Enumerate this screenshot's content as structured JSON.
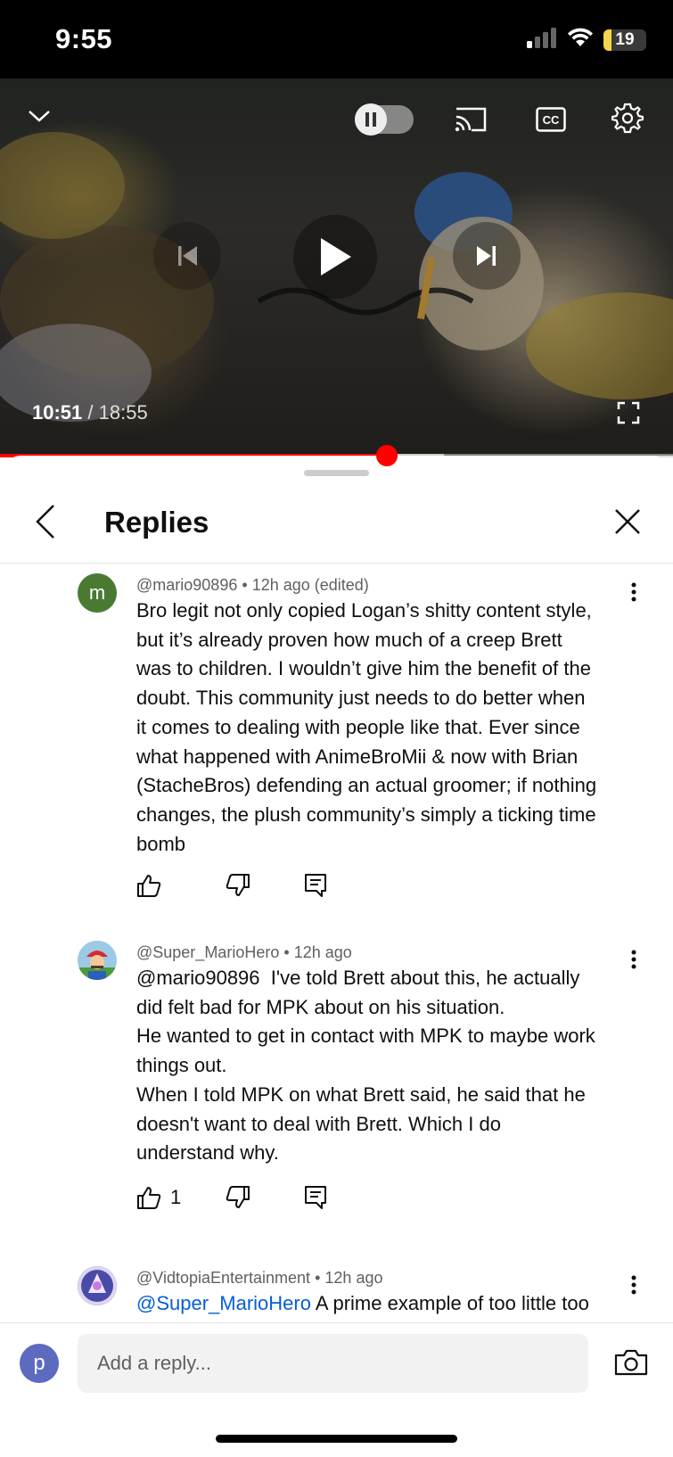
{
  "status_bar": {
    "time": "9:55",
    "battery": "19",
    "battery_level": 0.19
  },
  "video": {
    "current_time": "10:51",
    "duration": "/ 18:55",
    "played_fraction": 0.575,
    "buffered_fraction": 0.66,
    "icons": [
      "chevron-down-icon",
      "autoplay-toggle",
      "cast-icon",
      "captions-icon",
      "settings-icon",
      "previous-icon",
      "play-icon",
      "next-icon",
      "fullscreen-icon"
    ]
  },
  "sheet": {
    "title": "Replies"
  },
  "comments": [
    {
      "author": "@mario90896",
      "time": "12h ago (edited)",
      "avatar_letter": "m",
      "avatar_color": "#4a7a32",
      "lines": [
        "Bro legit not only copied Logan’s shitty content style,",
        "but it’s already proven how much of a creep Brett",
        "was to children. I wouldn’t give him the benefit of the",
        "doubt. This community just needs to do better when",
        "it comes to dealing with people like that. Ever since",
        "what happened with AnimeBroMii & now with Brian",
        "(StacheBros) defending an actual groomer; if nothing",
        "changes, the plush community’s simply a ticking time",
        "bomb"
      ],
      "likes": ""
    },
    {
      "author": "@Super_MarioHero",
      "time": "12h ago",
      "mention": "@mario90896",
      "lines": [
        "  I've told Brett about this, he actually",
        "did felt bad for MPK about on his situation.",
        "He wanted to get in contact with MPK to maybe work",
        "things out.",
        "When I told MPK on what Brett said, he said that he",
        "doesn't want to deal with Brett. Which I do",
        "understand why."
      ],
      "likes": "1"
    },
    {
      "author": "@VidtopiaEntertainment",
      "time": "12h ago",
      "mention": "@Super_MarioHero",
      "text": " A prime example of too little too"
    }
  ],
  "reply_bar": {
    "avatar_letter": "p",
    "avatar_color": "#5c6bc0",
    "placeholder": "Add a reply..."
  },
  "separator": "•"
}
